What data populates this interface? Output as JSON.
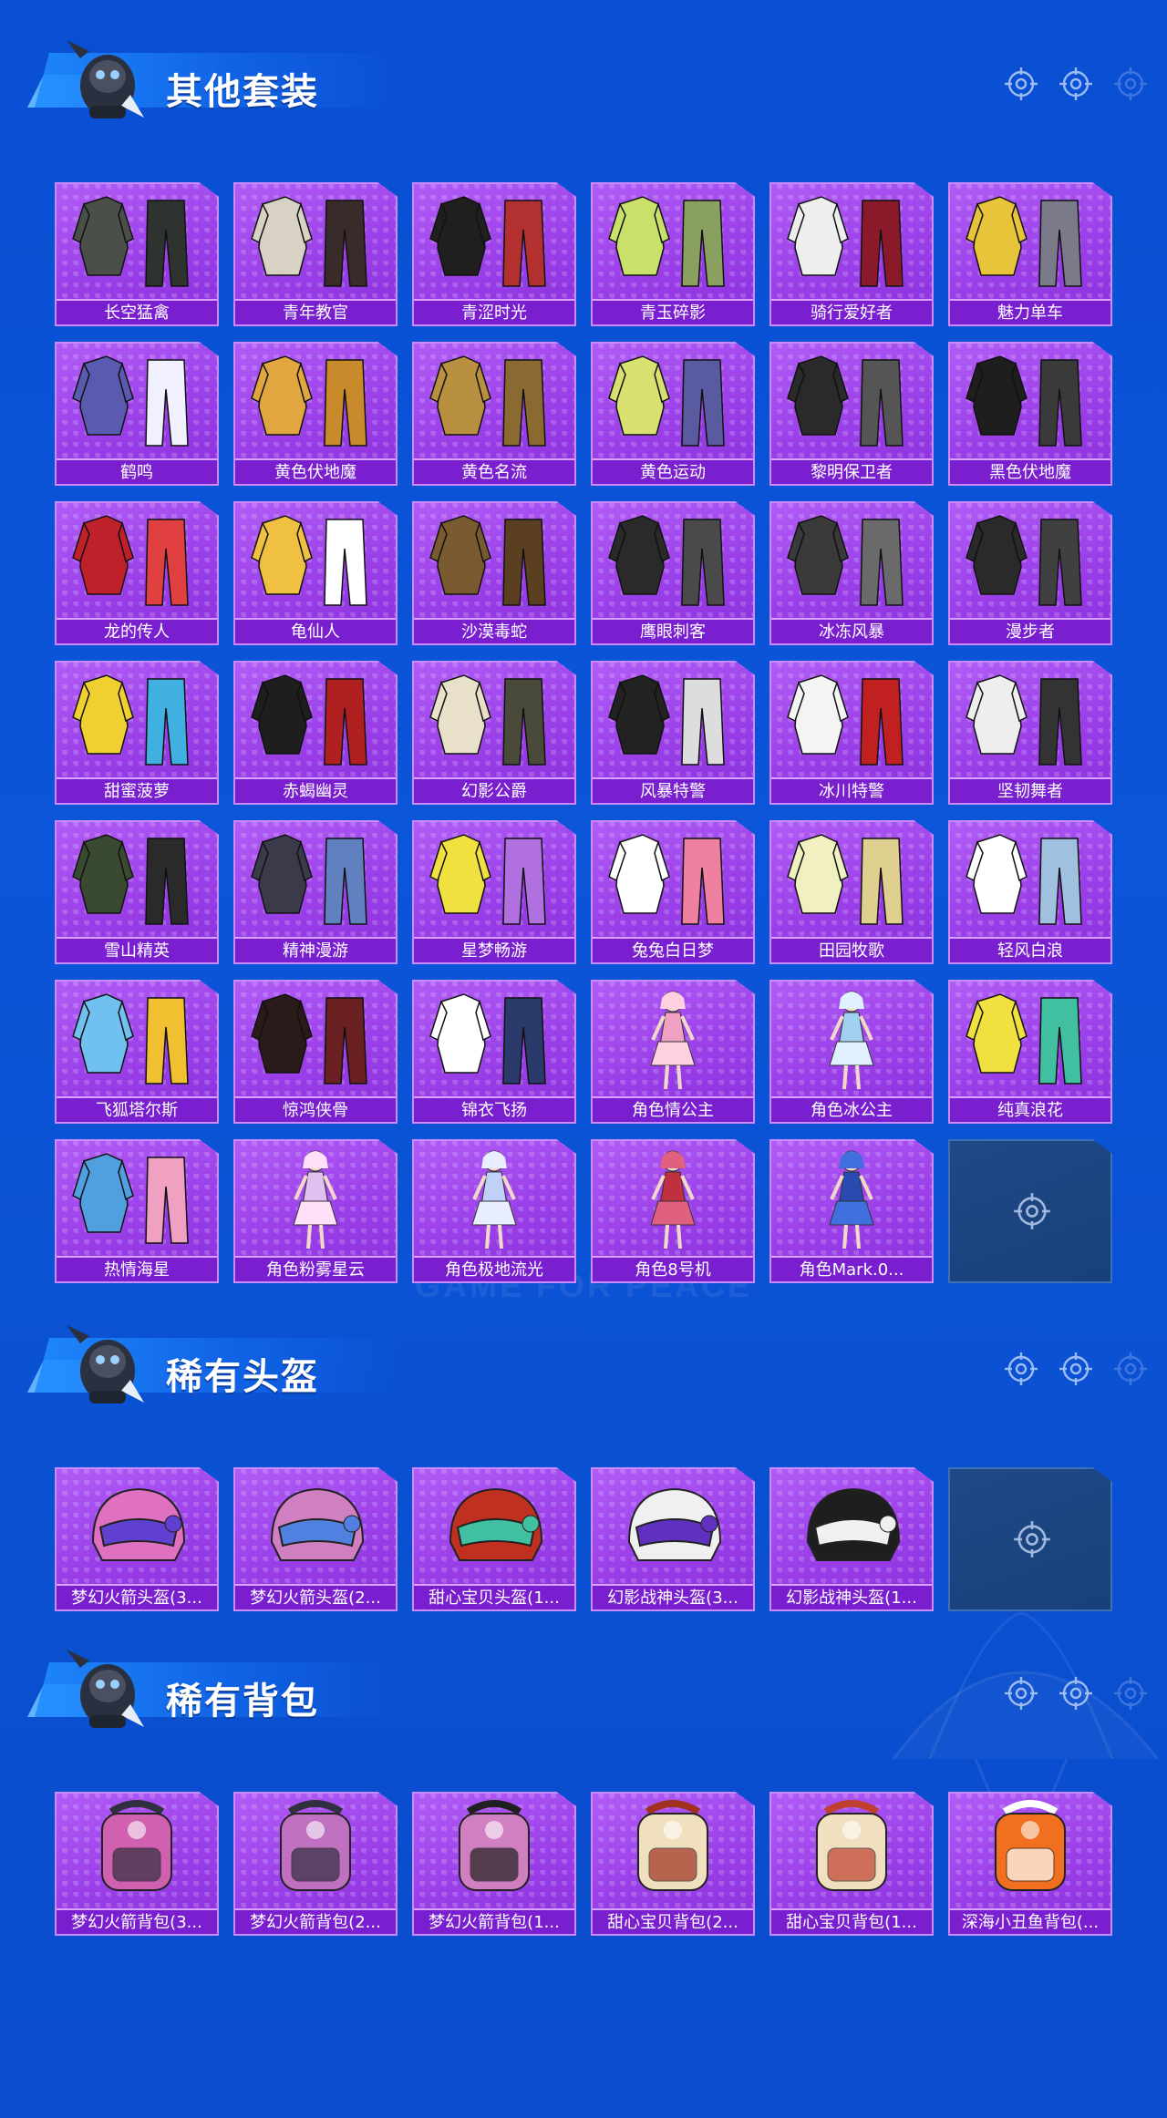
{
  "sections": [
    {
      "title": "其他套装",
      "items": [
        {
          "name": "长空猛禽",
          "kind": "outfit",
          "colors": [
            "#4a4f4a",
            "#2f332f"
          ]
        },
        {
          "name": "青年教官",
          "kind": "outfit",
          "colors": [
            "#d8d2c4",
            "#3a2b2b"
          ]
        },
        {
          "name": "青涩时光",
          "kind": "outfit",
          "colors": [
            "#1f1f1f",
            "#b23030"
          ]
        },
        {
          "name": "青玉碎影",
          "kind": "outfit",
          "colors": [
            "#c9e06a",
            "#8aa060"
          ]
        },
        {
          "name": "骑行爱好者",
          "kind": "outfit",
          "colors": [
            "#eeeeee",
            "#8a1a2a"
          ]
        },
        {
          "name": "魅力单车",
          "kind": "outfit",
          "colors": [
            "#e7c43a",
            "#7a7a8a"
          ]
        },
        {
          "name": "鹤鸣",
          "kind": "outfit",
          "colors": [
            "#5a5ab0",
            "#f0f0ff"
          ]
        },
        {
          "name": "黄色伏地魔",
          "kind": "outfit",
          "colors": [
            "#e2a640",
            "#c88a2a"
          ]
        },
        {
          "name": "黄色名流",
          "kind": "outfit",
          "colors": [
            "#b89040",
            "#8a6a30"
          ]
        },
        {
          "name": "黄色运动",
          "kind": "outfit",
          "colors": [
            "#d8e070",
            "#5a5aa0"
          ]
        },
        {
          "name": "黎明保卫者",
          "kind": "outfit",
          "colors": [
            "#2a2a2a",
            "#555555"
          ]
        },
        {
          "name": "黑色伏地魔",
          "kind": "outfit",
          "colors": [
            "#1e1e1e",
            "#3a3a3a"
          ]
        },
        {
          "name": "龙的传人",
          "kind": "outfit",
          "colors": [
            "#c0202a",
            "#e04040"
          ]
        },
        {
          "name": "龟仙人",
          "kind": "outfit",
          "colors": [
            "#f0c040",
            "#ffffff"
          ]
        },
        {
          "name": "沙漠毒蛇",
          "kind": "outfit",
          "colors": [
            "#7a5a30",
            "#5a4020"
          ]
        },
        {
          "name": "鹰眼刺客",
          "kind": "outfit",
          "colors": [
            "#2a2a2a",
            "#4a4a4a"
          ]
        },
        {
          "name": "冰冻风暴",
          "kind": "outfit",
          "colors": [
            "#3a3a3a",
            "#6a6a6a"
          ]
        },
        {
          "name": "漫步者",
          "kind": "outfit",
          "colors": [
            "#2a2a2a",
            "#404040"
          ]
        },
        {
          "name": "甜蜜菠萝",
          "kind": "outfit",
          "colors": [
            "#f0d030",
            "#40b0e0"
          ]
        },
        {
          "name": "赤蝎幽灵",
          "kind": "outfit",
          "colors": [
            "#1e1e1e",
            "#b02020"
          ]
        },
        {
          "name": "幻影公爵",
          "kind": "outfit",
          "colors": [
            "#e8e0c8",
            "#4a4a3a"
          ]
        },
        {
          "name": "风暴特警",
          "kind": "outfit",
          "colors": [
            "#222222",
            "#dddddd"
          ]
        },
        {
          "name": "冰川特警",
          "kind": "outfit",
          "colors": [
            "#f4f4f4",
            "#c02020"
          ]
        },
        {
          "name": "坚韧舞者",
          "kind": "outfit",
          "colors": [
            "#eeeeee",
            "#333333"
          ]
        },
        {
          "name": "雪山精英",
          "kind": "outfit",
          "colors": [
            "#3a4a30",
            "#2a2a2a"
          ]
        },
        {
          "name": "精神漫游",
          "kind": "outfit",
          "colors": [
            "#3a3a4a",
            "#6080c0"
          ]
        },
        {
          "name": "星梦畅游",
          "kind": "outfit",
          "colors": [
            "#f0e040",
            "#b070e0"
          ]
        },
        {
          "name": "兔兔白日梦",
          "kind": "outfit",
          "colors": [
            "#ffffff",
            "#f080a0"
          ]
        },
        {
          "name": "田园牧歌",
          "kind": "outfit",
          "colors": [
            "#f0f0c0",
            "#e0d090"
          ]
        },
        {
          "name": "轻风白浪",
          "kind": "outfit",
          "colors": [
            "#ffffff",
            "#a0c0e0"
          ]
        },
        {
          "name": "飞狐塔尔斯",
          "kind": "outfit",
          "colors": [
            "#70c0f0",
            "#f0c030"
          ]
        },
        {
          "name": "惊鸿侠骨",
          "kind": "outfit",
          "colors": [
            "#2a1a1a",
            "#6a2020"
          ]
        },
        {
          "name": "锦衣飞扬",
          "kind": "outfit",
          "colors": [
            "#ffffff",
            "#2a3a6a"
          ]
        },
        {
          "name": "角色情公主",
          "kind": "character",
          "colors": [
            "#f0a0c0",
            "#ffd0e0"
          ]
        },
        {
          "name": "角色冰公主",
          "kind": "character",
          "colors": [
            "#a0d0f0",
            "#e0f0ff"
          ]
        },
        {
          "name": "纯真浪花",
          "kind": "outfit",
          "colors": [
            "#f0e040",
            "#40c0a0"
          ]
        },
        {
          "name": "热情海星",
          "kind": "outfit",
          "colors": [
            "#50a0e0",
            "#f0a0c0"
          ]
        },
        {
          "name": "角色粉雾星云",
          "kind": "character",
          "colors": [
            "#e0c0f0",
            "#ffe0f8"
          ]
        },
        {
          "name": "角色极地流光",
          "kind": "character",
          "colors": [
            "#c0d0f8",
            "#e8eeff"
          ]
        },
        {
          "name": "角色8号机",
          "kind": "character",
          "colors": [
            "#c03040",
            "#e06080"
          ]
        },
        {
          "name": "角色Mark.0...",
          "kind": "character",
          "colors": [
            "#2a4ab0",
            "#4070e0"
          ]
        },
        {
          "name": "",
          "kind": "empty",
          "colors": []
        }
      ]
    },
    {
      "title": "稀有头盔",
      "items": [
        {
          "name": "梦幻火箭头盔(3...",
          "kind": "helmet",
          "colors": [
            "#e070c0",
            "#6040d0"
          ]
        },
        {
          "name": "梦幻火箭头盔(2...",
          "kind": "helmet",
          "colors": [
            "#d080c0",
            "#5080e0"
          ]
        },
        {
          "name": "甜心宝贝头盔(1...",
          "kind": "helmet",
          "colors": [
            "#c03020",
            "#40c0a0"
          ]
        },
        {
          "name": "幻影战神头盔(3...",
          "kind": "helmet",
          "colors": [
            "#f0f0f0",
            "#6030c0"
          ]
        },
        {
          "name": "幻影战神头盔(1...",
          "kind": "helmet",
          "colors": [
            "#1e1e1e",
            "#f0f0f0"
          ]
        },
        {
          "name": "",
          "kind": "empty",
          "colors": []
        }
      ]
    },
    {
      "title": "稀有背包",
      "items": [
        {
          "name": "梦幻火箭背包(3...",
          "kind": "backpack",
          "colors": [
            "#d060b0",
            "#303040"
          ]
        },
        {
          "name": "梦幻火箭背包(2...",
          "kind": "backpack",
          "colors": [
            "#c070c0",
            "#303040"
          ]
        },
        {
          "name": "梦幻火箭背包(1...",
          "kind": "backpack",
          "colors": [
            "#d080c0",
            "#202020"
          ]
        },
        {
          "name": "甜心宝贝背包(2...",
          "kind": "backpack",
          "colors": [
            "#f0e0c0",
            "#a03020"
          ]
        },
        {
          "name": "甜心宝贝背包(1...",
          "kind": "backpack",
          "colors": [
            "#f0e0c0",
            "#c04030"
          ]
        },
        {
          "name": "深海小丑鱼背包(...",
          "kind": "backpack",
          "colors": [
            "#f07020",
            "#ffffff"
          ]
        }
      ]
    }
  ],
  "theme": {
    "card": "#a24cef",
    "label_bar": "#7a1fd0",
    "empty": "#1f4a86",
    "background": "#0b55d8"
  },
  "watermark": "GAME FOR PEACE"
}
